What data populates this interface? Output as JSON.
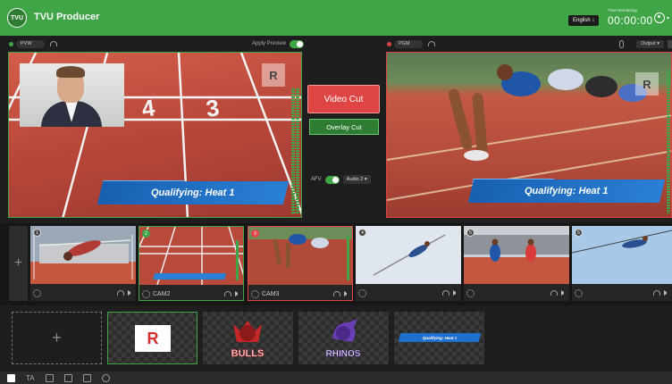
{
  "header": {
    "logo_text": "TVU",
    "title": "TVU Producer",
    "language": "English ↕",
    "time_label": "Time Remaining",
    "time_value": "00:00:00",
    "colors": {
      "brand": "#3fa546"
    }
  },
  "preview": {
    "label": "PVW",
    "apply_label": "Apply Preview",
    "apply_on": true,
    "lower_third": "Qualifying: Heat 1",
    "logo": "R"
  },
  "program": {
    "label": "PGM",
    "output_label": "Output ▾",
    "lower_third": "Qualifying: Heat 1",
    "logo": "R"
  },
  "controls": {
    "video_cut": "Video Cut",
    "overlay_cut": "Overlay Cut",
    "afv_label": "AFV",
    "afv_on": true,
    "audio_select": "Audio 2 ▾"
  },
  "cameras": [
    {
      "num": "1",
      "label": "",
      "state": "none"
    },
    {
      "num": "2",
      "label": "CAM2",
      "state": "preview"
    },
    {
      "num": "3",
      "label": "CAM3",
      "state": "program"
    },
    {
      "num": "4",
      "label": "",
      "state": "none"
    },
    {
      "num": "5",
      "label": "",
      "state": "none"
    },
    {
      "num": "6",
      "label": "",
      "state": "none"
    }
  ],
  "graphics": [
    {
      "name": "r-logo",
      "text": "R"
    },
    {
      "name": "bulls-logo",
      "text": "BULLS"
    },
    {
      "name": "rhinos-logo",
      "text": "RHINOS"
    },
    {
      "name": "lower-third-graphic",
      "text": "Qualifying: Heat 1"
    }
  ],
  "add_symbol": "+",
  "toolbar": {
    "items": [
      "layout-icon",
      "text-icon",
      "layers-icon",
      "list-icon",
      "film-icon",
      "history-icon"
    ],
    "text_glyph": "TA"
  }
}
